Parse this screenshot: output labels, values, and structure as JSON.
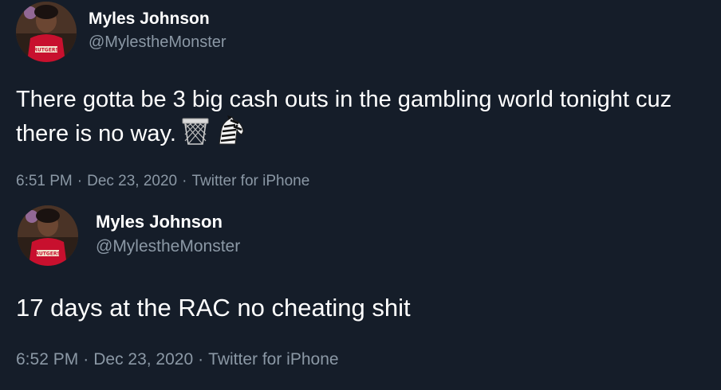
{
  "tweets": [
    {
      "author_name": "Myles Johnson",
      "author_handle": "@MylestheMonster",
      "text": "There gotta be 3 big cash outs in the gambling world tonight cuz there is no way.",
      "emojis": [
        "basketball-hoop-icon",
        "zebra-icon"
      ],
      "time": "6:51 PM",
      "date": "Dec 23, 2020",
      "source": "Twitter for iPhone",
      "separator": "·"
    },
    {
      "author_name": "Myles Johnson",
      "author_handle": "@MylestheMonster",
      "text": "17 days at the RAC no cheating shit",
      "time": "6:52 PM",
      "date": "Dec 23, 2020",
      "source": "Twitter for iPhone",
      "separator": "·"
    }
  ],
  "colors": {
    "background": "#151d29",
    "primary_text": "#ffffff",
    "secondary_text": "#8b98a5",
    "jersey_red": "#c8102e"
  }
}
